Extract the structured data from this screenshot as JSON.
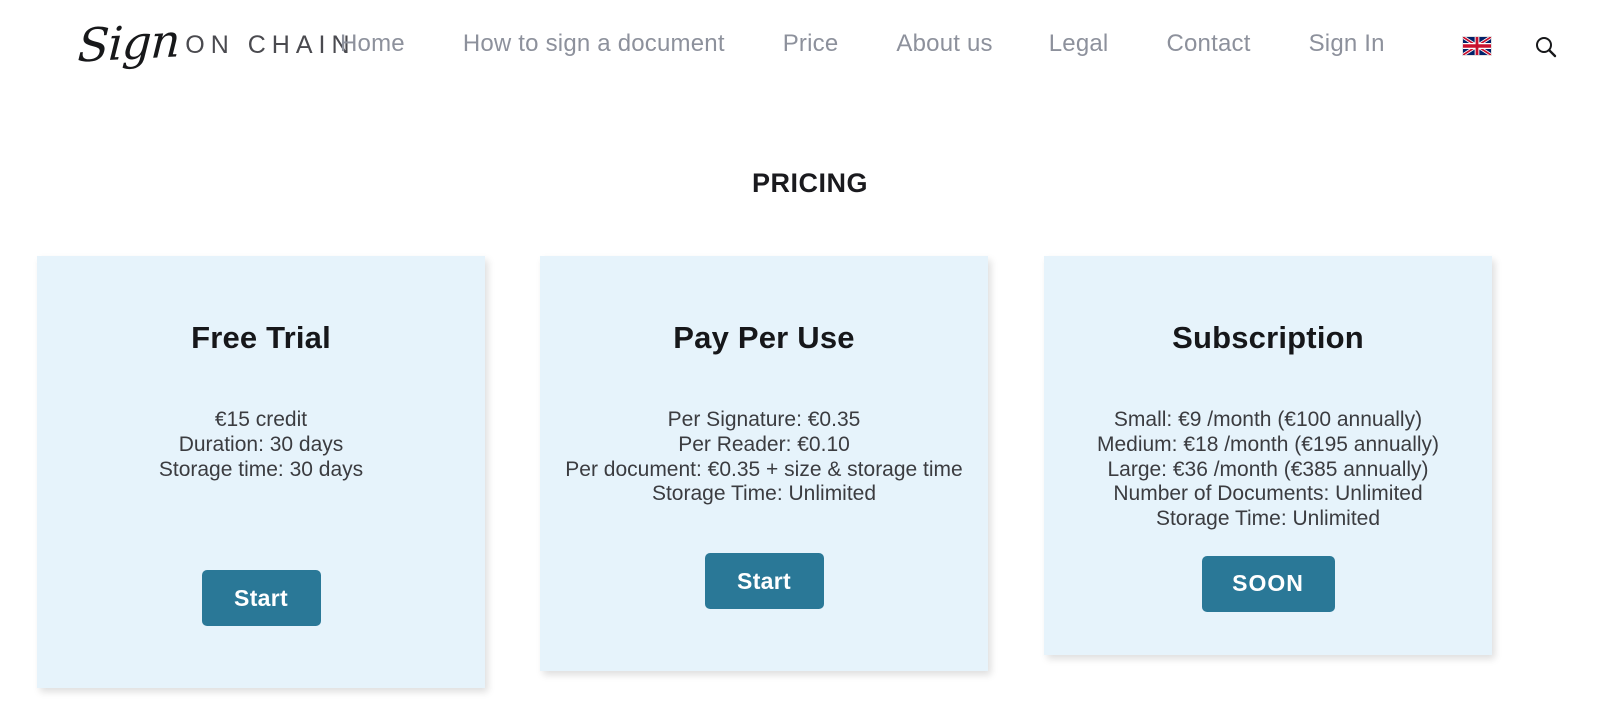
{
  "header": {
    "logo": {
      "script_text": "Sign",
      "word_text": "ON CHAIN"
    },
    "nav": [
      {
        "label": "Home"
      },
      {
        "label": "How to sign a document"
      },
      {
        "label": "Price"
      },
      {
        "label": "About us"
      },
      {
        "label": "Legal"
      },
      {
        "label": "Contact"
      },
      {
        "label": "Sign In"
      }
    ],
    "language": {
      "icon": "uk-flag-icon",
      "code": "EN"
    },
    "search": {
      "icon": "search-icon"
    }
  },
  "main": {
    "page_title": "PRICING",
    "cards": [
      {
        "title": "Free Trial",
        "lines": [
          "€15 credit",
          "Duration: 30 days",
          "Storage time: 30 days"
        ],
        "button": "Start"
      },
      {
        "title": "Pay Per Use",
        "lines": [
          "Per Signature: €0.35",
          "Per Reader: €0.10",
          "Per document: €0.35 + size & storage time",
          "Storage Time: Unlimited"
        ],
        "button": "Start"
      },
      {
        "title": "Subscription",
        "lines": [
          "Small: €9 /month (€100 annually)",
          "Medium: €18 /month (€195 annually)",
          "Large: €36 /month (€385 annually)",
          "Number of Documents: Unlimited",
          "Storage Time: Unlimited"
        ],
        "button": "SOON"
      }
    ]
  },
  "colors": {
    "card_background": "#e6f3fb",
    "button": "#2a7897",
    "nav_text": "#8d919c",
    "title_text": "#1a1a1e"
  }
}
